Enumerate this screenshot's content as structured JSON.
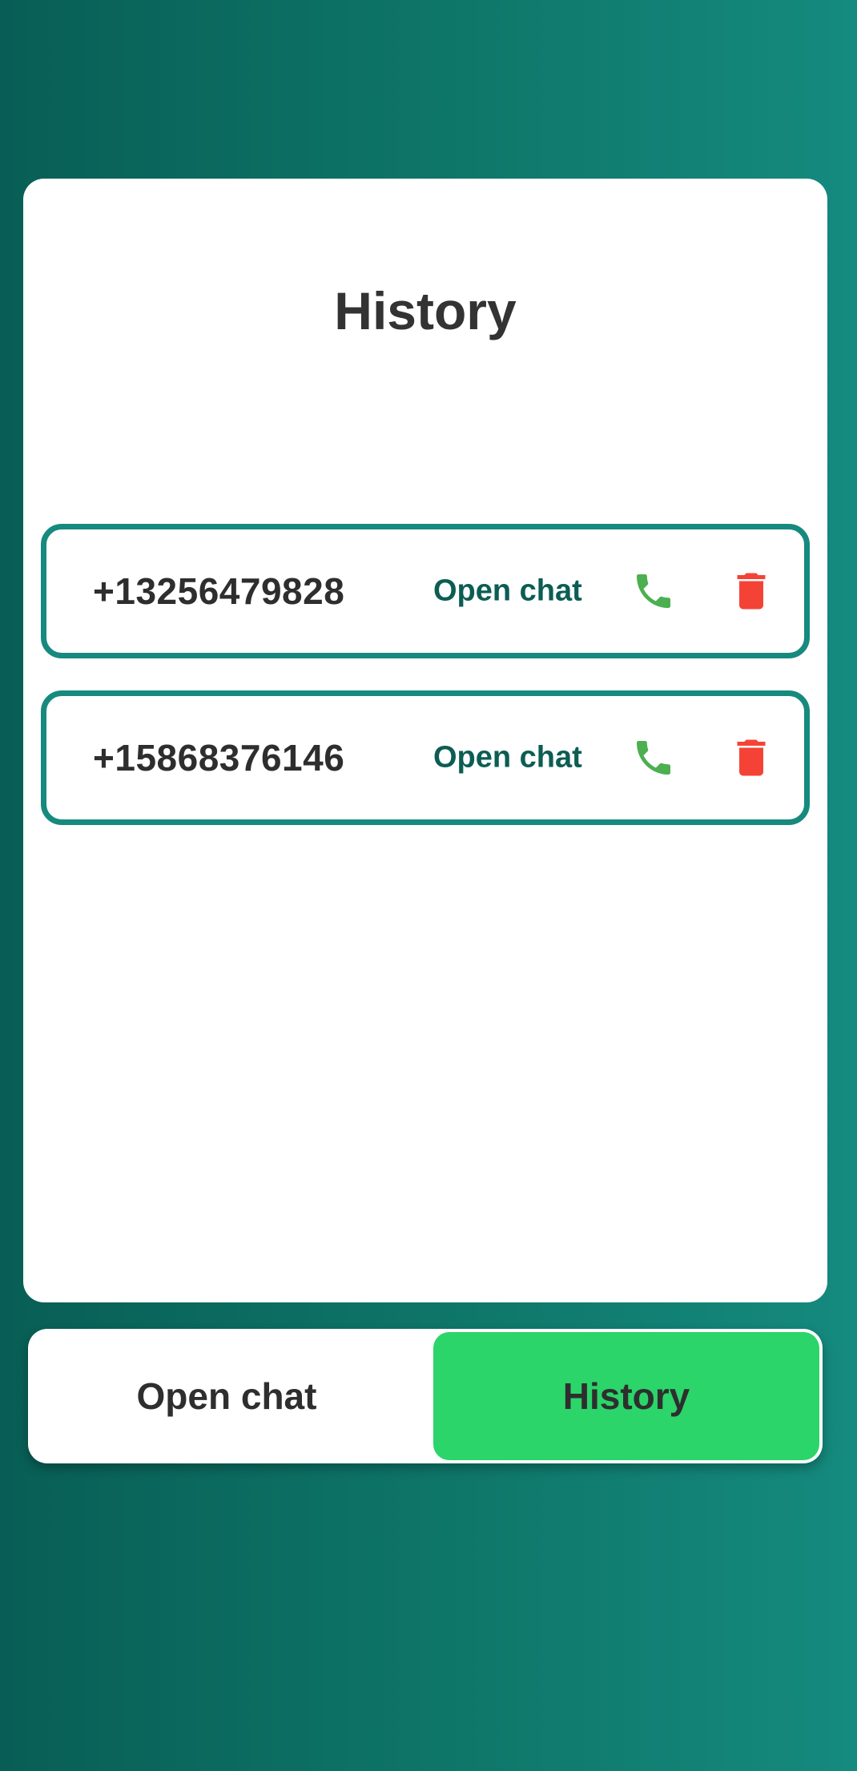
{
  "page": {
    "title": "History"
  },
  "history": {
    "items": [
      {
        "phone": "+13256479828",
        "open_label": "Open chat",
        "call_icon": "phone-icon",
        "delete_icon": "trash-icon"
      },
      {
        "phone": "+15868376146",
        "open_label": "Open chat",
        "call_icon": "phone-icon",
        "delete_icon": "trash-icon"
      }
    ]
  },
  "tabs": {
    "open_chat": "Open chat",
    "history": "History",
    "active": "history"
  },
  "colors": {
    "accent": "#168a7e",
    "active_tab": "#2bd56a",
    "call": "#4caf50",
    "delete": "#f44336",
    "link": "#0c5d53"
  }
}
